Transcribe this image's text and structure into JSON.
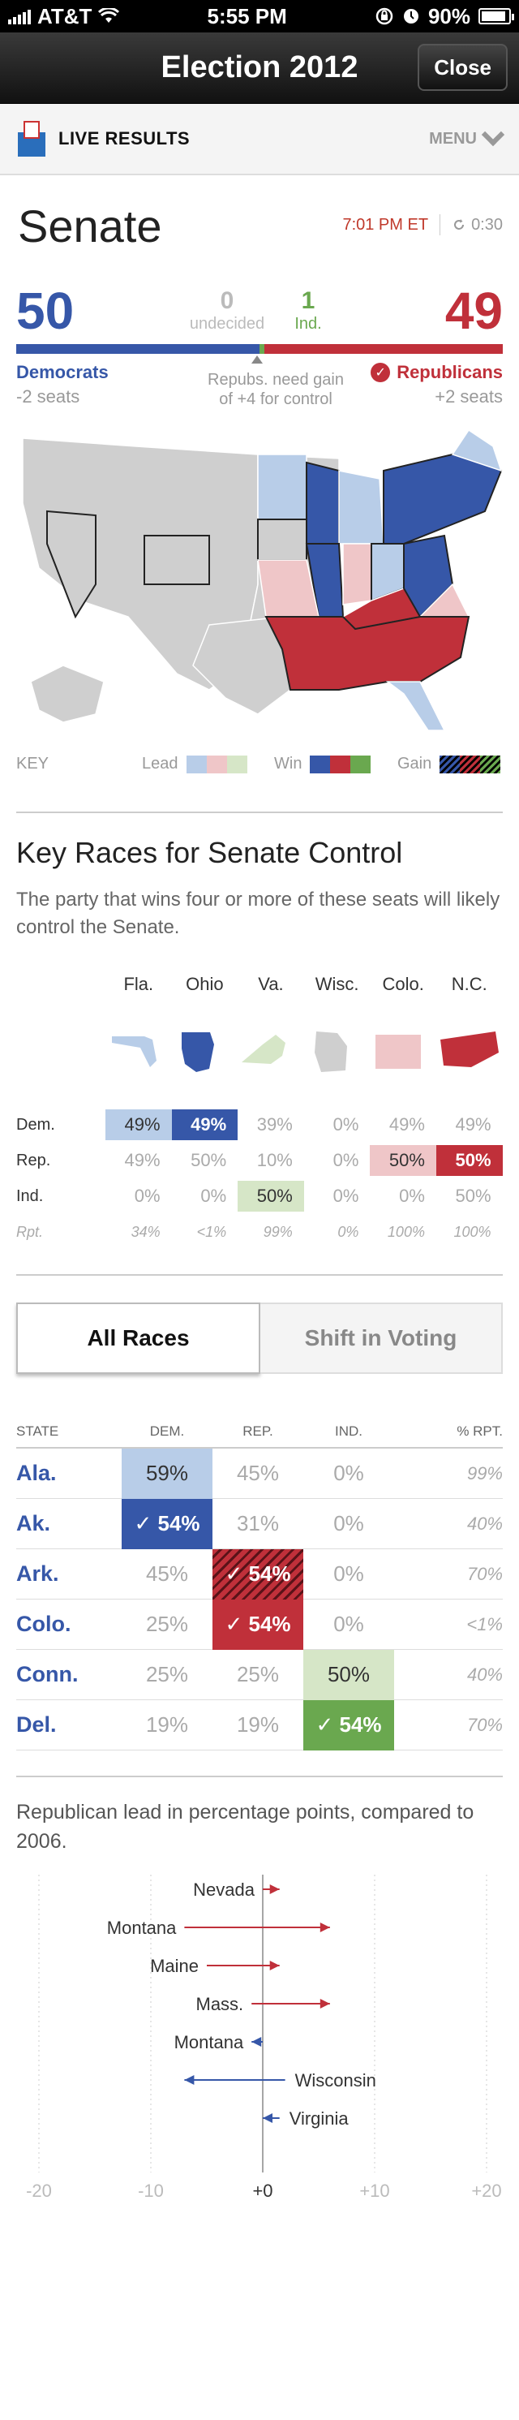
{
  "status_bar": {
    "carrier": "AT&T",
    "time": "5:55 PM",
    "battery": "90%"
  },
  "nav": {
    "title": "Election 2012",
    "close_label": "Close"
  },
  "live_bar": {
    "brand": "LIVE RESULTS",
    "menu": "MENU"
  },
  "senate": {
    "title": "Senate",
    "timestamp": "7:01 PM ET",
    "countdown": "0:30",
    "dem_seats": "50",
    "rep_seats": "49",
    "undecided_count": "0",
    "undecided_label": "undecided",
    "ind_count": "1",
    "ind_label": "Ind.",
    "dem_party": "Democrats",
    "dem_change": "-2 seats",
    "rep_party": "Republicans",
    "rep_change": "+2 seats",
    "need_line1": "Repubs. need gain",
    "need_line2": "of +4 for control",
    "bar_fractions": {
      "dem": 50,
      "undecided": 0,
      "ind": 1,
      "rep": 49
    }
  },
  "key": {
    "label": "KEY",
    "lead_label": "Lead",
    "win_label": "Win",
    "gain_label": "Gain",
    "colors": {
      "dem_lead": "#b8cde8",
      "rep_lead": "#efc6c8",
      "ind_lead": "#d6e6c7",
      "dem_win": "#3657a8",
      "rep_win": "#c0303a",
      "ind_win": "#6aa84f"
    }
  },
  "key_races": {
    "title": "Key Races for Senate Control",
    "subtitle": "The party that wins four or more of these seats will likely control the Senate.",
    "states": [
      "Fla.",
      "Ohio",
      "Va.",
      "Wisc.",
      "Colo.",
      "N.C."
    ],
    "state_colors": [
      "#b8cde8",
      "#3657a8",
      "#d6e6c7",
      "#cfcfcf",
      "#efc6c8",
      "#c0303a"
    ],
    "rows": [
      {
        "label": "Dem.",
        "values": [
          "49%",
          "49%",
          "39%",
          "0%",
          "49%",
          "49%"
        ],
        "fills": [
          "#b8cde8",
          "#3657a8",
          "",
          "",
          "",
          ""
        ],
        "text_colors": [
          "#333",
          "#fff",
          "",
          "",
          "",
          ""
        ]
      },
      {
        "label": "Rep.",
        "values": [
          "49%",
          "50%",
          "10%",
          "0%",
          "50%",
          "50%"
        ],
        "fills": [
          "",
          "",
          "",
          "",
          "#efc6c8",
          "#c0303a"
        ],
        "text_colors": [
          "",
          "",
          "",
          "",
          "#333",
          "#fff"
        ]
      },
      {
        "label": "Ind.",
        "values": [
          "0%",
          "0%",
          "50%",
          "0%",
          "0%",
          "50%"
        ],
        "fills": [
          "",
          "",
          "#d6e6c7",
          "",
          "",
          ""
        ],
        "text_colors": [
          "",
          "",
          "#333",
          "",
          "",
          ""
        ]
      },
      {
        "label": "Rpt.",
        "values": [
          "34%",
          "<1%",
          "99%",
          "0%",
          "100%",
          "100%"
        ],
        "fills": [
          "",
          "",
          "",
          "",
          "",
          ""
        ],
        "text_colors": [
          "",
          "",
          "",
          "",
          "",
          ""
        ],
        "italic": true
      }
    ]
  },
  "tabs": [
    {
      "label": "All Races",
      "active": true
    },
    {
      "label": "Shift in Voting",
      "active": false
    }
  ],
  "state_table": {
    "headers": [
      "STATE",
      "DEM.",
      "REP.",
      "IND.",
      "% RPT."
    ],
    "rows": [
      {
        "state": "Ala.",
        "dem": "59%",
        "rep": "45%",
        "ind": "0%",
        "rpt": "99%",
        "win": "dem",
        "level": "lead"
      },
      {
        "state": "Ak.",
        "dem": "✓ 54%",
        "rep": "31%",
        "ind": "0%",
        "rpt": "40%",
        "win": "dem",
        "level": "win"
      },
      {
        "state": "Ark.",
        "dem": "45%",
        "rep": "✓ 54%",
        "ind": "0%",
        "rpt": "70%",
        "win": "rep",
        "level": "gain"
      },
      {
        "state": "Colo.",
        "dem": "25%",
        "rep": "✓ 54%",
        "ind": "0%",
        "rpt": "<1%",
        "win": "rep",
        "level": "win"
      },
      {
        "state": "Conn.",
        "dem": "25%",
        "rep": "25%",
        "ind": "50%",
        "rpt": "40%",
        "win": "ind",
        "level": "lead"
      },
      {
        "state": "Del.",
        "dem": "19%",
        "rep": "19%",
        "ind": "✓ 54%",
        "rpt": "70%",
        "win": "ind",
        "level": "win"
      }
    ]
  },
  "shift": {
    "title": "Republican lead in percentage points, compared to 2006.",
    "chart_data": {
      "type": "arrow",
      "xlim": [
        -20,
        20
      ],
      "ticks": [
        "-20",
        "-10",
        "+0",
        "+10",
        "+20"
      ],
      "tick_values": [
        -20,
        -10,
        0,
        10,
        20
      ],
      "rows": [
        {
          "name": "Nevada",
          "from": 0,
          "to": 1.5
        },
        {
          "name": "Montana",
          "from": -7,
          "to": 6
        },
        {
          "name": "Maine",
          "from": -5,
          "to": 1.5
        },
        {
          "name": "Mass.",
          "from": -1,
          "to": 6
        },
        {
          "name": "Montana",
          "from": 0,
          "to": -1
        },
        {
          "name": "Wisconsin",
          "from": 2,
          "to": -7
        },
        {
          "name": "Virginia",
          "from": 1.5,
          "to": 0
        }
      ]
    }
  }
}
